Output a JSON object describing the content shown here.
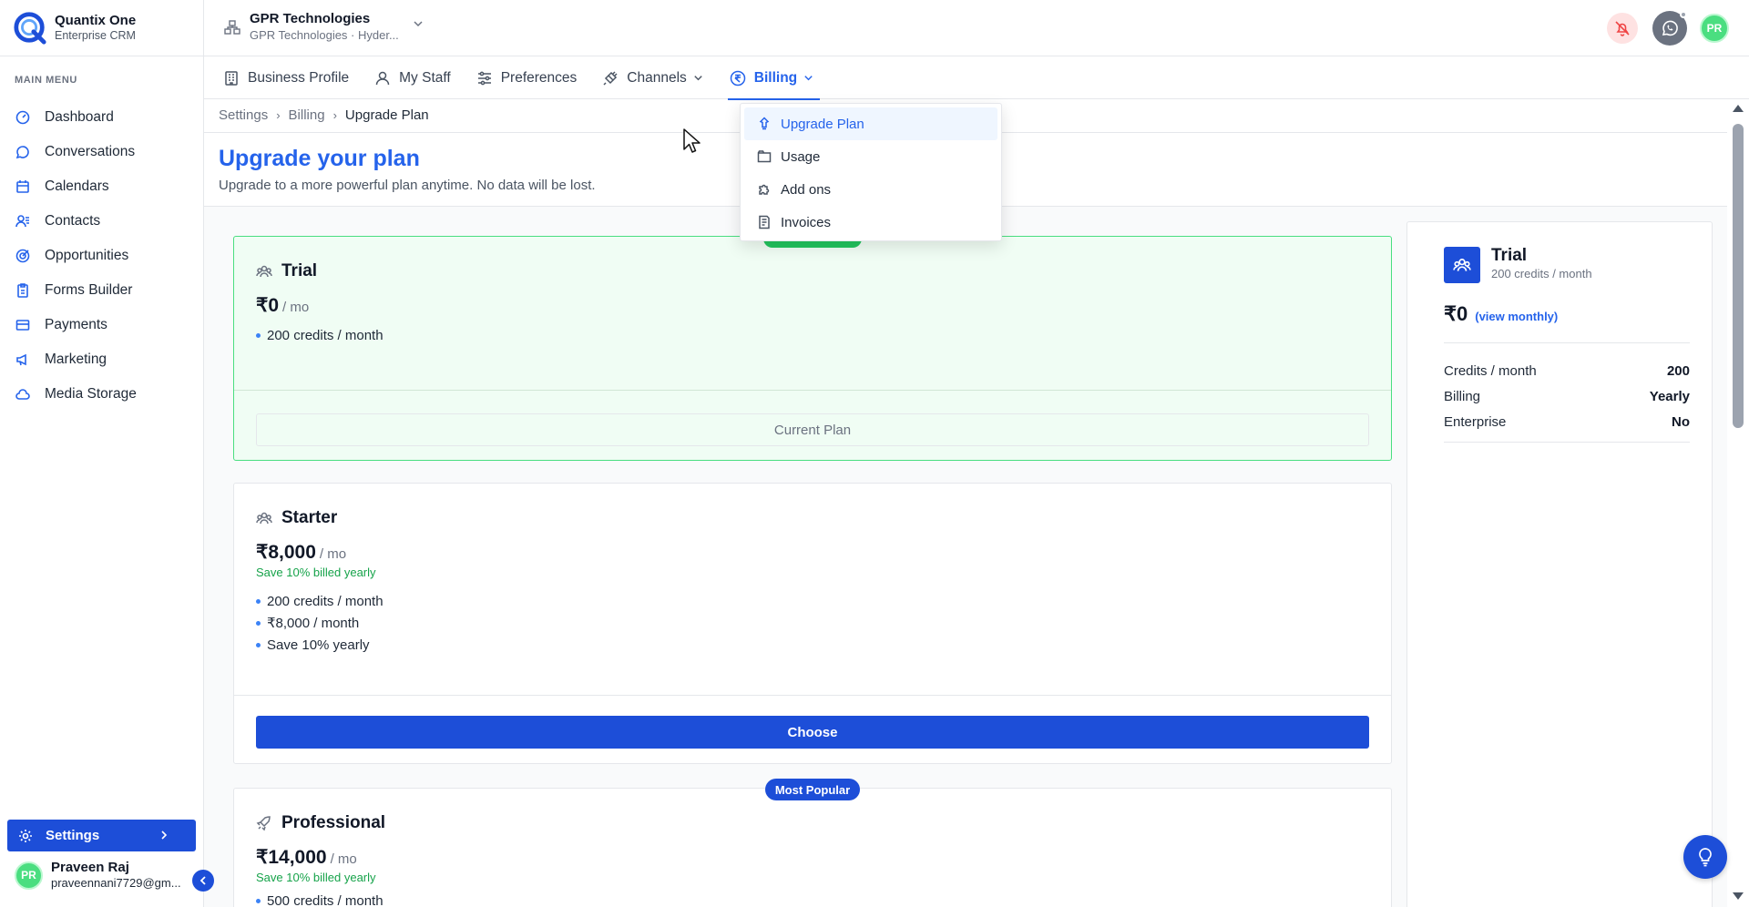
{
  "brand": {
    "name": "Quantix One",
    "subtitle": "Enterprise CRM"
  },
  "sidebar": {
    "section_label": "MAIN MENU",
    "items": [
      {
        "label": "Dashboard",
        "icon": "dashboard-icon"
      },
      {
        "label": "Conversations",
        "icon": "chat-icon"
      },
      {
        "label": "Calendars",
        "icon": "calendar-icon"
      },
      {
        "label": "Contacts",
        "icon": "contacts-icon"
      },
      {
        "label": "Opportunities",
        "icon": "target-icon"
      },
      {
        "label": "Forms Builder",
        "icon": "clipboard-icon"
      },
      {
        "label": "Payments",
        "icon": "card-icon"
      },
      {
        "label": "Marketing",
        "icon": "megaphone-icon"
      },
      {
        "label": "Media Storage",
        "icon": "cloud-icon"
      }
    ],
    "settings_label": "Settings",
    "user": {
      "initials": "PR",
      "name": "Praveen Raj",
      "email": "praveennani7729@gm..."
    }
  },
  "header": {
    "org_name": "GPR Technologies",
    "org_sub": "GPR Technologies · Hyder...",
    "avatar_initials": "PR"
  },
  "tabs": [
    {
      "label": "Business Profile",
      "icon": "building-icon"
    },
    {
      "label": "My Staff",
      "icon": "user-icon"
    },
    {
      "label": "Preferences",
      "icon": "sliders-icon"
    },
    {
      "label": "Channels",
      "icon": "plug-icon"
    },
    {
      "label": "Billing",
      "icon": "rupee-circle-icon"
    }
  ],
  "billing_menu": {
    "items": [
      {
        "label": "Upgrade Plan",
        "icon": "rocket-icon"
      },
      {
        "label": "Usage",
        "icon": "folder-icon"
      },
      {
        "label": "Add ons",
        "icon": "puzzle-icon"
      },
      {
        "label": "Invoices",
        "icon": "invoice-icon"
      }
    ]
  },
  "breadcrumb": {
    "items": [
      "Settings",
      "Billing",
      "Upgrade Plan"
    ],
    "separator": "›"
  },
  "page": {
    "title": "Upgrade your plan",
    "subtitle": "Upgrade to a more powerful plan anytime. No data will be lost."
  },
  "plans": [
    {
      "name": "Trial",
      "price": "₹0",
      "per": "/ mo",
      "features": [
        "200 credits / month"
      ],
      "button": "Current Plan"
    },
    {
      "name": "Starter",
      "price": "₹8,000",
      "per": "/ mo",
      "save": "Save 10% billed yearly",
      "features": [
        "200 credits / month",
        "₹8,000 / month",
        "Save 10% yearly"
      ],
      "button": "Choose"
    },
    {
      "name": "Professional",
      "price": "₹14,000",
      "per": "/ mo",
      "save": "Save 10% billed yearly",
      "badge": "Most Popular",
      "features": [
        "500 credits / month"
      ]
    }
  ],
  "summary": {
    "name": "Trial",
    "credits": "200 credits / month",
    "price": "₹0",
    "price_link": "(view monthly)",
    "rows": [
      {
        "label": "Credits / month",
        "value": "200"
      },
      {
        "label": "Billing",
        "value": "Yearly"
      },
      {
        "label": "Enterprise",
        "value": "No"
      }
    ]
  },
  "colors": {
    "accent": "#1d4ed8",
    "link": "#2563eb",
    "current_plan_bg": "#f0fdf4",
    "current_plan_border": "#4ade80",
    "save_text": "#16a34a"
  }
}
